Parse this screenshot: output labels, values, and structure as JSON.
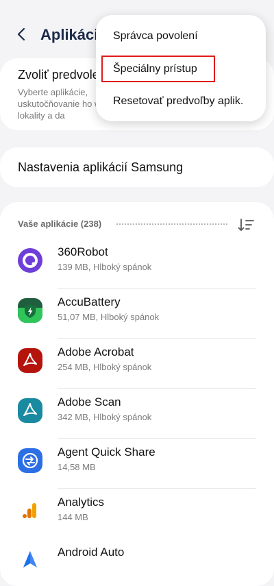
{
  "header": {
    "title": "Aplikáci"
  },
  "default_apps_card": {
    "title": "Zvoliť predvole",
    "subtitle": "Vyberte aplikácie, uskutočňovanie ho webové lokality a da"
  },
  "samsung_card": {
    "title": "Nastavenia aplikácií Samsung"
  },
  "apps_section": {
    "header": "Vaše aplikácie (238)",
    "apps": [
      {
        "name": "360Robot",
        "meta": "139 MB, Hlboký spánok",
        "icon": "360robot-icon"
      },
      {
        "name": "AccuBattery",
        "meta": "51,07 MB, Hlboký spánok",
        "icon": "accubattery-icon"
      },
      {
        "name": "Adobe Acrobat",
        "meta": "254 MB, Hlboký spánok",
        "icon": "adobe-acrobat-icon"
      },
      {
        "name": "Adobe Scan",
        "meta": "342 MB, Hlboký spánok",
        "icon": "adobe-scan-icon"
      },
      {
        "name": "Agent Quick Share",
        "meta": "14,58 MB",
        "icon": "quick-share-icon"
      },
      {
        "name": "Analytics",
        "meta": "144 MB",
        "icon": "analytics-icon"
      },
      {
        "name": "Android Auto",
        "meta": "",
        "icon": "android-auto-icon"
      }
    ]
  },
  "menu": {
    "items": [
      {
        "label": "Správca povolení"
      },
      {
        "label": "Špeciálny prístup"
      },
      {
        "label": "Resetovať predvoľby aplik."
      }
    ]
  },
  "colors": {
    "highlight": "#e11a1a",
    "title": "#1b2a4a"
  }
}
